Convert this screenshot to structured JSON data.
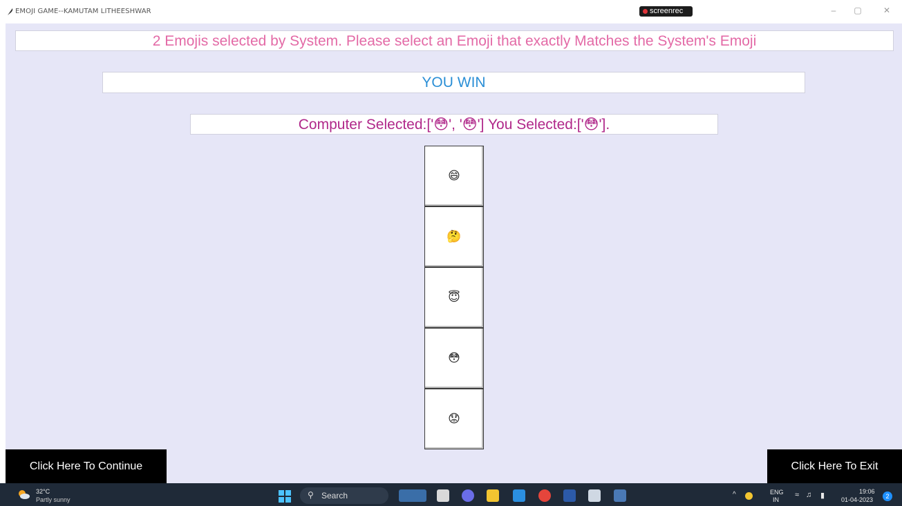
{
  "window": {
    "title": "EMOJI GAME--KAMUTAM LITHEESHWAR",
    "recorder_label": "screenrec",
    "controls": [
      "–",
      "▢",
      "✕"
    ]
  },
  "game": {
    "instruction": "2 Emojis selected by System. Please select an Emoji that exactly Matches the System's Emoji",
    "result": "YOU WIN",
    "selection_text": "Computer Selected:['😳', '😳'] You Selected:['😳'].",
    "emoji_buttons": [
      "😄",
      "🤔",
      "😇",
      "😳",
      "😟"
    ],
    "continue_label": "Click Here To Continue",
    "exit_label": "Click Here To Exit"
  },
  "taskbar": {
    "weather_temp": "32°C",
    "weather_condition": "Partly sunny",
    "search_label": "Search",
    "language": "ENG",
    "region": "IN",
    "time": "19:06",
    "date": "01-04-2023",
    "notification_count": "2"
  },
  "colors": {
    "app_background": "#e6e6f7",
    "instruction_text": "#e36aa6",
    "result_text": "#2b8fd6",
    "selection_text": "#b0288a"
  }
}
